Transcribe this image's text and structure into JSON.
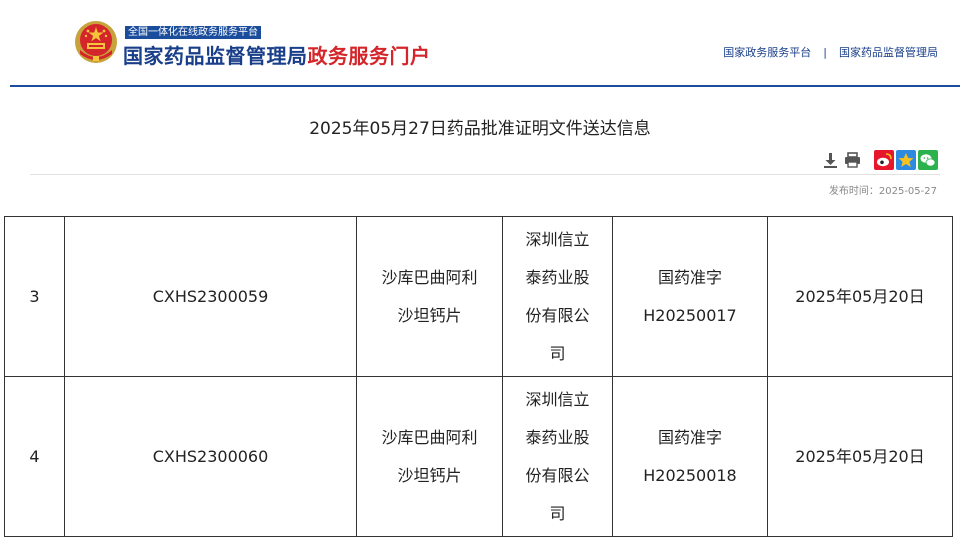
{
  "header": {
    "tagline": "全国一体化在线政务服务平台",
    "brand_blue": "国家药品监督管理局",
    "brand_red": "政务服务门户",
    "nav": [
      "国家政务服务平台",
      "国家药品监督管理局"
    ],
    "nav_separator": "|"
  },
  "article": {
    "title": "2025年05月27日药品批准证明文件送达信息",
    "publish_label": "发布时间：",
    "publish_date": "2025-05-27",
    "tools": [
      "download-icon",
      "print-icon",
      "weibo-icon",
      "qzone-icon",
      "wechat-icon"
    ]
  },
  "table": {
    "rows": [
      {
        "no": "3",
        "code": "CXHS2300059",
        "drug_l1": "沙库巴曲阿利",
        "drug_l2": "沙坦钙片",
        "company_lines": [
          "深圳信立",
          "泰药业股",
          "份有限公",
          "司"
        ],
        "approval_l1": "国药准字",
        "approval_l2": "H20250017",
        "date": "2025年05月20日"
      },
      {
        "no": "4",
        "code": "CXHS2300060",
        "drug_l1": "沙库巴曲阿利",
        "drug_l2": "沙坦钙片",
        "company_lines": [
          "深圳信立",
          "泰药业股",
          "份有限公",
          "司"
        ],
        "approval_l1": "国药准字",
        "approval_l2": "H20250018",
        "date": "2025年05月20日"
      }
    ]
  },
  "colors": {
    "brand_blue": "#1a3f8a",
    "brand_red": "#d3252a",
    "header_rule": "#1a4d9c",
    "weibo": "#e6162d",
    "qzone": "#2c8ae0",
    "wechat": "#2bb24c"
  }
}
